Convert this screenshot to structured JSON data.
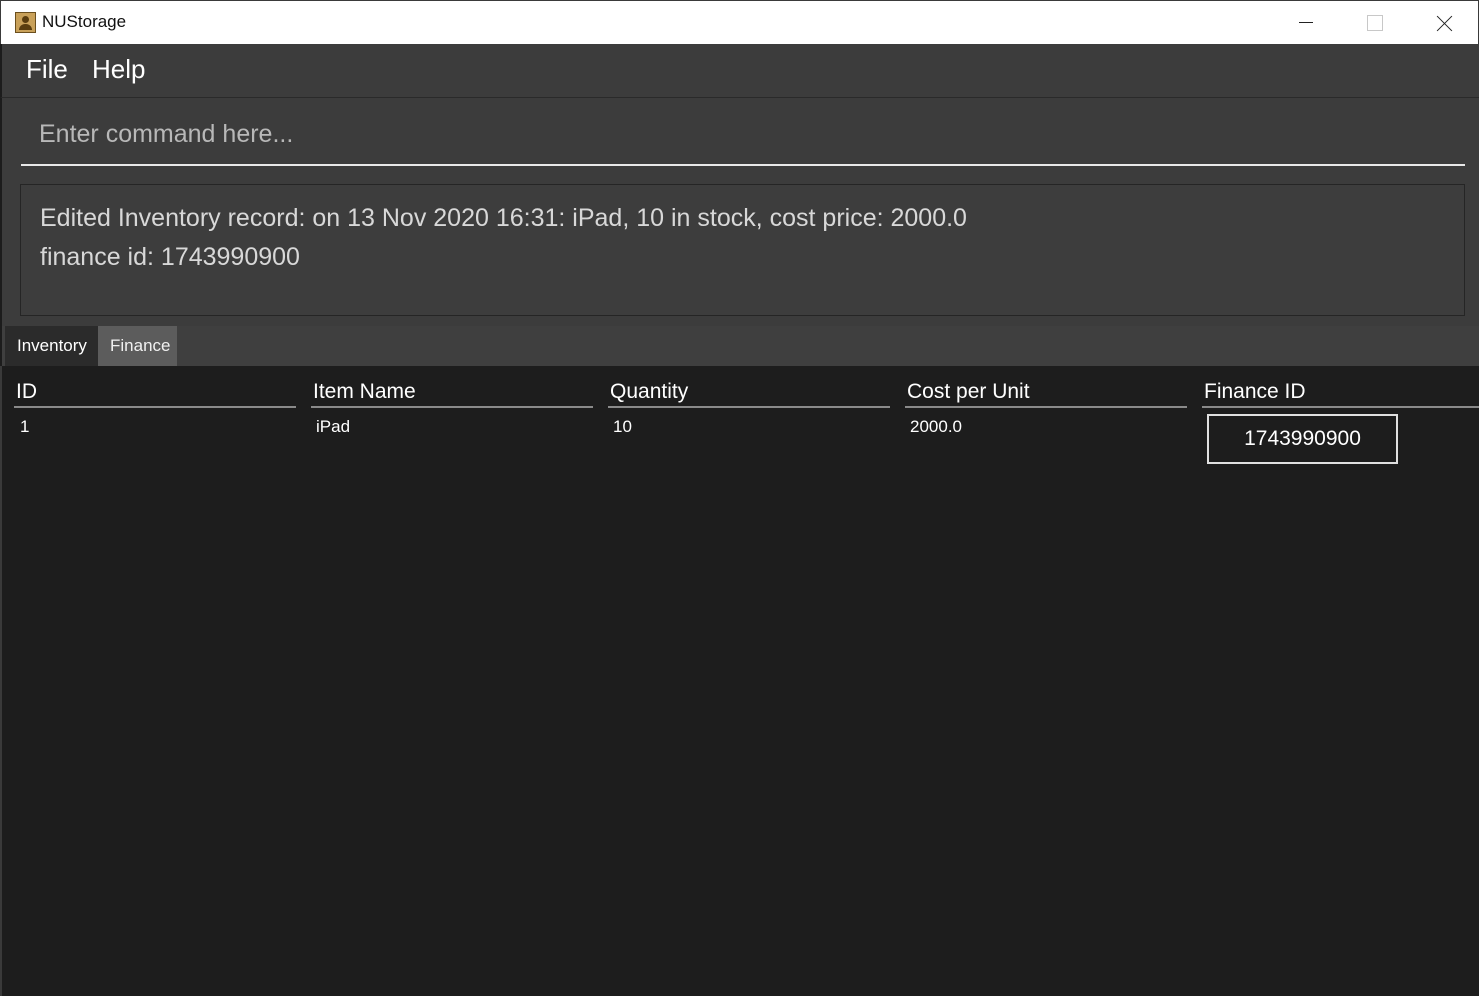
{
  "window": {
    "title": "NUStorage",
    "icon": "storage-app-icon"
  },
  "menu": {
    "items": [
      "File",
      "Help"
    ]
  },
  "command": {
    "placeholder": "Enter command here...",
    "value": ""
  },
  "result": {
    "lines": [
      "Edited Inventory record: on 13 Nov 2020 16:31: iPad, 10 in stock, cost price: 2000.0",
      "finance id: 1743990900"
    ]
  },
  "tabs": [
    {
      "label": "Inventory",
      "selected": true
    },
    {
      "label": "Finance",
      "selected": false
    }
  ],
  "table": {
    "columns": [
      "ID",
      "Item Name",
      "Quantity",
      "Cost per Unit",
      "Finance ID"
    ],
    "rows": [
      {
        "id": "1",
        "item_name": "iPad",
        "quantity": "10",
        "cost_per_unit": "2000.0",
        "finance_id": "1743990900"
      }
    ]
  }
}
